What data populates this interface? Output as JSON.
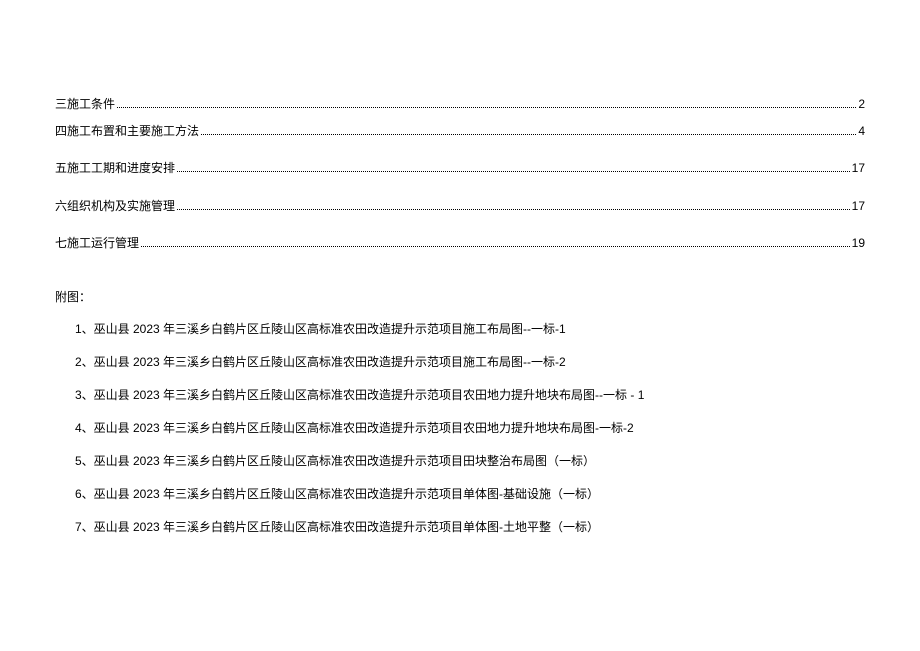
{
  "toc": [
    {
      "title": "三施工条件",
      "page": "2",
      "spaced": false
    },
    {
      "title": "四施工布置和主要施工方法",
      "page": "4",
      "spaced": false
    },
    {
      "title": "五施工工期和进度安排",
      "page": "17",
      "spaced": true
    },
    {
      "title": "六组织机构及实施管理",
      "page": "17",
      "spaced": true
    },
    {
      "title": "七施工运行管理",
      "page": "19",
      "spaced": true
    }
  ],
  "attachment_header": "附图：",
  "attachments": [
    "1、巫山县 2023 年三溪乡白鹤片区丘陵山区高标准农田改造提升示范项目施工布局图--一标-1",
    "2、巫山县 2023 年三溪乡白鹤片区丘陵山区高标准农田改造提升示范项目施工布局图--一标-2",
    "3、巫山县 2023 年三溪乡白鹤片区丘陵山区高标准农田改造提升示范项目农田地力提升地块布局图--一标 - 1",
    "4、巫山县 2023 年三溪乡白鹤片区丘陵山区高标准农田改造提升示范项目农田地力提升地块布局图-一标-2",
    "5、巫山县 2023 年三溪乡白鹤片区丘陵山区高标准农田改造提升示范项目田块整治布局图（一标）",
    "6、巫山县 2023 年三溪乡白鹤片区丘陵山区高标准农田改造提升示范项目单体图-基础设施（一标）",
    "7、巫山县 2023 年三溪乡白鹤片区丘陵山区高标准农田改造提升示范项目单体图-土地平整（一标）"
  ]
}
